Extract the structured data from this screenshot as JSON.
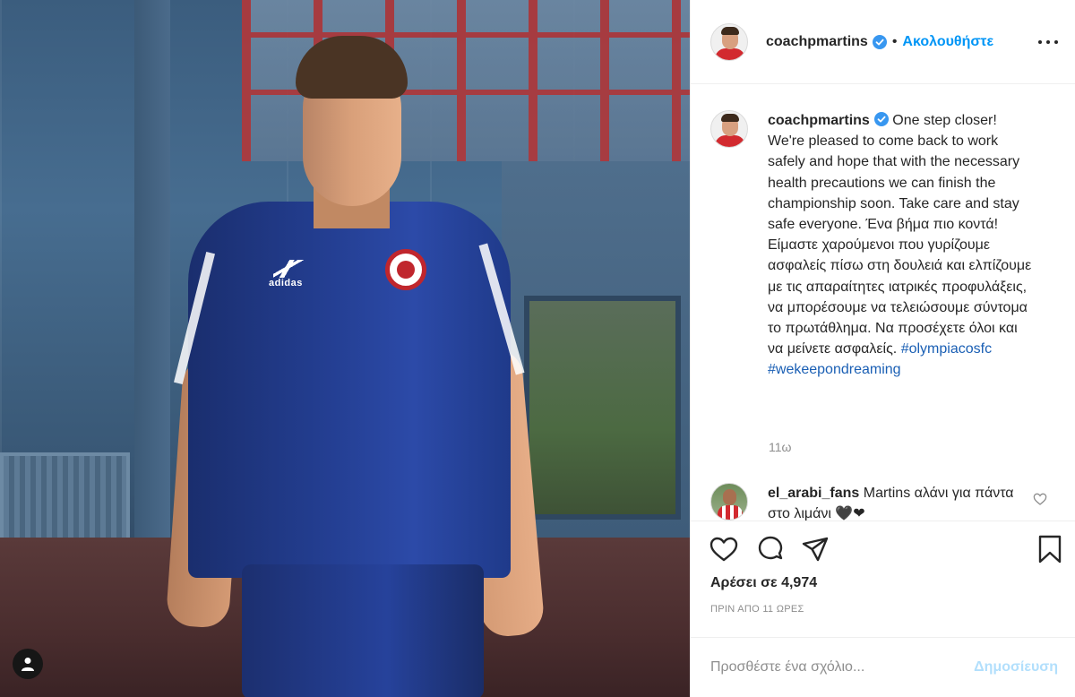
{
  "post": {
    "author": "coachpmartins",
    "follow_label": "Ακολουθήστε",
    "separator": "•",
    "caption_en": "One step closer! We're pleased to come back to work safely and hope that with the necessary health precautions we can finish the championship soon. Take care and stay safe everyone.",
    "caption_gr": "Ένα βήμα πιο κοντά! Είμαστε χαρούμενοι που γυρίζουμε ασφαλείς πίσω στη δουλειά και ελπίζουμε με τις απαραίτητες ιατρικές προφυλάξεις, να μπορέσουμε να τελειώσουμε σύντομα το πρωτάθλημα. Να προσέχετε όλοι και να μείνετε ασφαλείς.",
    "hashtags": [
      "#olympiacosfc",
      "#wekeepondreaming"
    ],
    "time_ago": "11ω"
  },
  "photo": {
    "shirt_brand": "adidas"
  },
  "comments": [
    {
      "user": "el_arabi_fans",
      "text": "Martins αλάνι για πάντα στο λιμάνι 🖤❤"
    }
  ],
  "stats": {
    "likes_label": "Αρέσει σε 4,974",
    "posted": "ΠΡΙΝ ΑΠΟ 11 ΩΡΕΣ"
  },
  "composer": {
    "placeholder": "Προσθέστε ένα σχόλιο...",
    "post_label": "Δημοσίευση"
  },
  "colors": {
    "link_blue": "#0095f6",
    "post_disabled": "#b2dffc",
    "muted": "#8e8e8e",
    "verified_blue": "#3897f0"
  },
  "icons": [
    "user-tag-icon",
    "verified-badge-icon",
    "more-options-icon",
    "heart-icon",
    "comment-icon",
    "share-icon",
    "bookmark-icon",
    "small-heart-icon"
  ]
}
